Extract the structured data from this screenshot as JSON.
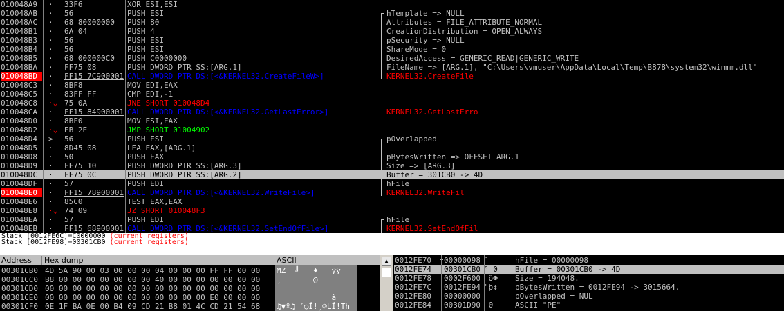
{
  "disasm": {
    "rows": [
      {
        "addr": "010048A9",
        "mark": "·",
        "hex": "33F6",
        "asm": "XOR ESI,ESI",
        "asm_type": "normal",
        "comment": "",
        "bp": false,
        "sel": false
      },
      {
        "addr": "010048AB",
        "mark": "·",
        "hex": "56",
        "asm": "PUSH ESI",
        "asm_type": "normal",
        "comment": "hTemplate => NULL",
        "bp": false,
        "sel": false
      },
      {
        "addr": "010048AC",
        "mark": "·",
        "hex": "68 80000000",
        "asm": "PUSH 80",
        "asm_type": "normal",
        "comment": "Attributes = FILE_ATTRIBUTE_NORMAL",
        "bp": false,
        "sel": false
      },
      {
        "addr": "010048B1",
        "mark": "·",
        "hex": "6A 04",
        "asm": "PUSH 4",
        "asm_type": "normal",
        "comment": "CreationDistribution = OPEN_ALWAYS",
        "bp": false,
        "sel": false
      },
      {
        "addr": "010048B3",
        "mark": "·",
        "hex": "56",
        "asm": "PUSH ESI",
        "asm_type": "normal",
        "comment": "pSecurity => NULL",
        "bp": false,
        "sel": false
      },
      {
        "addr": "010048B4",
        "mark": "·",
        "hex": "56",
        "asm": "PUSH ESI",
        "asm_type": "normal",
        "comment": "ShareMode = 0",
        "bp": false,
        "sel": false
      },
      {
        "addr": "010048B5",
        "mark": "·",
        "hex": "68 000000C0",
        "asm": "PUSH C0000000",
        "asm_type": "normal",
        "comment": "DesiredAccess = GENERIC_READ|GENERIC_WRITE",
        "bp": false,
        "sel": false
      },
      {
        "addr": "010048BA",
        "mark": "·",
        "hex": "FF75 08",
        "asm": "PUSH DWORD PTR SS:[ARG.1]",
        "asm_type": "normal",
        "comment": "FileName => [ARG.1], \"C:\\Users\\vmuser\\AppData\\Local\\Temp\\B878\\system32\\winmm.dll\"",
        "bp": false,
        "sel": false
      },
      {
        "addr": "010048BD",
        "mark": "·",
        "hex": "FF15 7C900001",
        "asm": "CALL DWORD PTR DS:[<&KERNEL32.CreateFileW>]",
        "asm_type": "call",
        "comment": "KERNEL32.CreateFile",
        "comment_type": "red",
        "bp": true,
        "sel": false
      },
      {
        "addr": "010048C3",
        "mark": "·",
        "hex": "8BF8",
        "asm": "MOV EDI,EAX",
        "asm_type": "normal",
        "comment": "",
        "bp": false,
        "sel": false
      },
      {
        "addr": "010048C5",
        "mark": "·",
        "hex": "83FF FF",
        "asm": "CMP EDI,-1",
        "asm_type": "normal",
        "comment": "",
        "bp": false,
        "sel": false
      },
      {
        "addr": "010048C8",
        "mark": "·⌄",
        "hex": "75 0A",
        "asm": "JNE SHORT 010048D4",
        "asm_type": "jcc",
        "comment": "",
        "bp": false,
        "sel": false
      },
      {
        "addr": "010048CA",
        "mark": "·",
        "hex": "FF15 84900001",
        "asm": "CALL DWORD PTR DS:[<&KERNEL32.GetLastError>]",
        "asm_type": "call",
        "comment": "KERNEL32.GetLastErro",
        "comment_type": "red",
        "bp": false,
        "sel": false
      },
      {
        "addr": "010048D0",
        "mark": "·",
        "hex": "8BF0",
        "asm": "MOV ESI,EAX",
        "asm_type": "normal",
        "comment": "",
        "bp": false,
        "sel": false
      },
      {
        "addr": "010048D2",
        "mark": "·⌄",
        "hex": "EB 2E",
        "asm": "JMP SHORT 01004902",
        "asm_type": "jmp",
        "comment": "",
        "bp": false,
        "sel": false
      },
      {
        "addr": "010048D4",
        "mark": ">",
        "hex": "56",
        "asm": "PUSH ESI",
        "asm_type": "normal",
        "comment": "pOverlapped",
        "bp": false,
        "sel": false
      },
      {
        "addr": "010048D5",
        "mark": "·",
        "hex": "8D45 08",
        "asm": "LEA EAX,[ARG.1]",
        "asm_type": "normal",
        "comment": "",
        "bp": false,
        "sel": false
      },
      {
        "addr": "010048D8",
        "mark": "·",
        "hex": "50",
        "asm": "PUSH EAX",
        "asm_type": "normal",
        "comment": "pBytesWritten => OFFSET ARG.1",
        "bp": false,
        "sel": false
      },
      {
        "addr": "010048D9",
        "mark": "·",
        "hex": "FF75 10",
        "asm": "PUSH DWORD PTR SS:[ARG.3]",
        "asm_type": "normal",
        "comment": "Size => [ARG.3]",
        "bp": false,
        "sel": false
      },
      {
        "addr": "010048DC",
        "mark": "·",
        "hex": "FF75 0C",
        "asm": "PUSH DWORD PTR SS:[ARG.2]",
        "asm_type": "normal",
        "comment": "Buffer = 301CB0 -> 4D",
        "bp": false,
        "sel": true
      },
      {
        "addr": "010048DF",
        "mark": "·",
        "hex": "57",
        "asm": "PUSH EDI",
        "asm_type": "normal",
        "comment": "hFile",
        "bp": false,
        "sel": false
      },
      {
        "addr": "010048E0",
        "mark": "·",
        "hex": "FF15 78900001",
        "asm": "CALL DWORD PTR DS:[<&KERNEL32.WriteFile>]",
        "asm_type": "call",
        "comment": "KERNEL32.WriteFil",
        "comment_type": "red",
        "bp": true,
        "sel": false
      },
      {
        "addr": "010048E6",
        "mark": "·",
        "hex": "85C0",
        "asm": "TEST EAX,EAX",
        "asm_type": "normal",
        "comment": "",
        "bp": false,
        "sel": false
      },
      {
        "addr": "010048E8",
        "mark": "·⌄",
        "hex": "74 09",
        "asm": "JZ SHORT 010048F3",
        "asm_type": "jcc",
        "comment": "",
        "bp": false,
        "sel": false
      },
      {
        "addr": "010048EA",
        "mark": "·",
        "hex": "57",
        "asm": "PUSH EDI",
        "asm_type": "normal",
        "comment": "hFile",
        "bp": false,
        "sel": false
      },
      {
        "addr": "010048EB",
        "mark": "·",
        "hex": "FF15 68900001",
        "asm": "CALL DWORD PTR DS:[<&KERNEL32.SetEndOfFile>]",
        "asm_type": "call",
        "comment": "KERNEL32.SetEndOfFil",
        "comment_type": "red",
        "bp": false,
        "sel": false
      }
    ]
  },
  "info": {
    "line1_prefix": "Stack [0012FE6C]=C0000000 ",
    "line1_suffix": "(current registers)",
    "line2_prefix": "Stack [0012FE98]=00301CB0 ",
    "line2_suffix": "(current registers)"
  },
  "dump": {
    "headers": {
      "address": "Address",
      "hex": "Hex dump",
      "ascii": "ASCII"
    },
    "rows": [
      {
        "addr": "00301CB0",
        "hex": "4D 5A 90 00 03 00 00 00 04 00 00 00 FF FF 00 00",
        "ascii": "MZ  ╝   ♦   ÿÿ"
      },
      {
        "addr": "00301CC0",
        "hex": "B8 00 00 00 00 00 00 00 40 00 00 00 00 00 00 00",
        "ascii": "¸       @"
      },
      {
        "addr": "00301CD0",
        "hex": "00 00 00 00 00 00 00 00 00 00 00 00 00 00 00 00",
        "ascii": ""
      },
      {
        "addr": "00301CE0",
        "hex": "00 00 00 00 00 00 00 00 00 00 00 00 E0 00 00 00",
        "ascii": "            à"
      },
      {
        "addr": "00301CF0",
        "hex": "0E 1F BA 0E 00 B4 09 CD 21 B8 01 4C CD 21 54 68",
        "ascii": "♫▼º♫ ´○Í!¸☺LÍ!Th"
      }
    ]
  },
  "stack": {
    "rows": [
      {
        "addr": "0012FE70",
        "val": "00000098",
        "asc": "˜",
        "cmt": "hFile = 00000098",
        "sel": false
      },
      {
        "addr": "0012FE74",
        "val": "00301CB0",
        "asc": "° 0",
        "cmt": "Buffer = 00301CB0 -> 4D",
        "sel": true
      },
      {
        "addr": "0012FE78",
        "val": "0002F600",
        "asc": " ö☻",
        "cmt": "Size = 194048.",
        "sel": false
      },
      {
        "addr": "0012FE7C",
        "val": "0012FE94",
        "asc": "\"þ↕",
        "cmt": "pBytesWritten = 0012FE94 -> 3015664.",
        "sel": false
      },
      {
        "addr": "0012FE80",
        "val": "00000000",
        "asc": "",
        "cmt": "pOverlapped = NUL",
        "sel": false
      },
      {
        "addr": "0012FE84",
        "val": "00301D90",
        "asc": " 0",
        "cmt": "ASCII \"PE\"",
        "sel": false
      }
    ]
  },
  "colors": {
    "call": "#0000ff",
    "jcc": "#ff0000",
    "jmp": "#00ff00",
    "breakpoint": "#ff0000",
    "selection": "#c0c0c0"
  }
}
